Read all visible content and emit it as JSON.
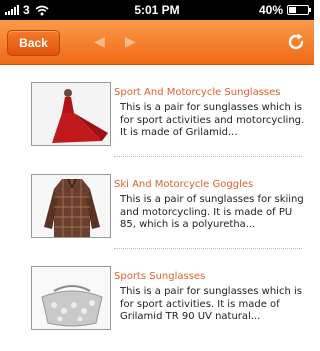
{
  "status": {
    "carrier": "3",
    "time": "5:01 PM",
    "battery": "40%",
    "battery_level": 0.4
  },
  "nav": {
    "back_label": "Back",
    "prev_icon": "chevron-left-icon",
    "next_icon": "chevron-right-icon",
    "refresh_icon": "refresh-icon"
  },
  "products": [
    {
      "title": "Sport And Motorcycle Sunglasses",
      "description": "This is a pair for sunglasses which is for sport activities and motorcycling. It is made of Grilamid..."
    },
    {
      "title": "Ski And Motorcycle Goggles",
      "description": "This is a pair of sunglasses for skiing and motorcycling. It is made of PU 85, which is a polyuretha..."
    },
    {
      "title": "Sports Sunglasses",
      "description": "This is a pair for sunglasses which is for sport activities. It is made of Grilamid TR 90 UV natural..."
    }
  ],
  "colors": {
    "nav_top": "#fb9a4a",
    "nav_bottom": "#f06a14",
    "title": "#e2602a"
  }
}
